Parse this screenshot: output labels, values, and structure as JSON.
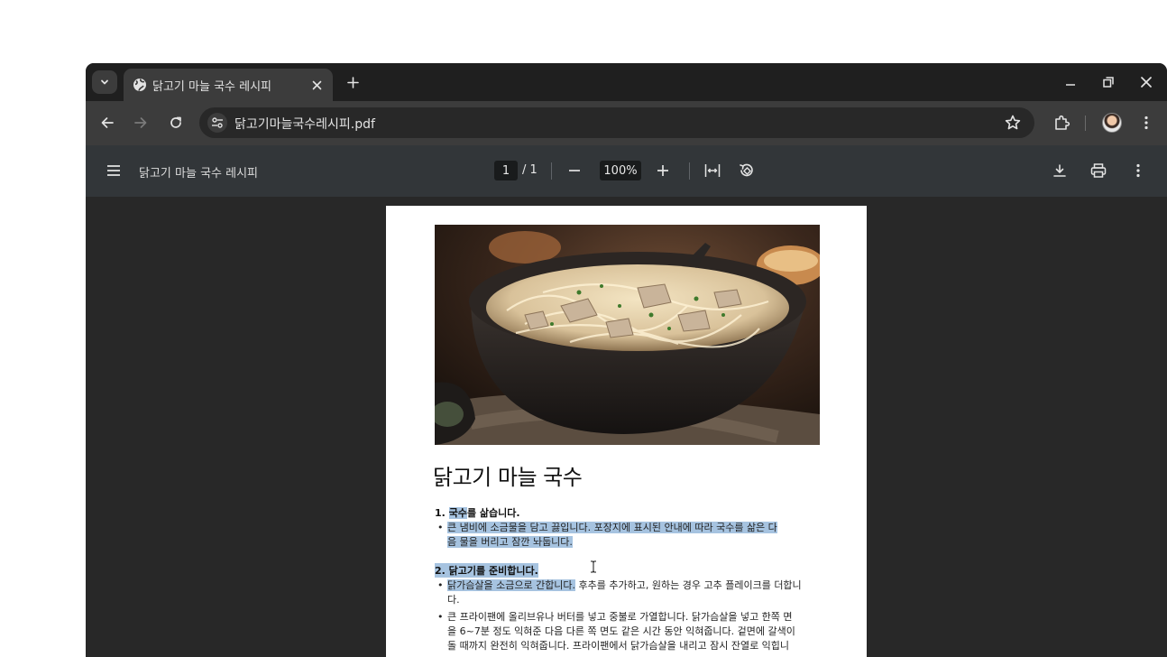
{
  "browser": {
    "tab_title": "닭고기 마늘 국수 레시피",
    "url": "닭고기마늘국수레시피.pdf"
  },
  "pdf_toolbar": {
    "title": "닭고기 마늘 국수 레시피",
    "page_current": "1",
    "page_total": "/ 1",
    "zoom": "100%"
  },
  "document": {
    "title": "닭고기 마늘 국수",
    "step1_heading_hl": "국수",
    "step1_heading_rest": "를 삶습니다.",
    "step1_number": "1.",
    "step1_bullet_line1": "큰 냄비에 소금물을 담고 끓입니다. 포장지에 표시된 안내에 따라 국수를 삶은 다",
    "step1_bullet_line2": "음 물을 버리고 잠깐 놔둡니다.",
    "step2_heading": "2. 닭고기를 준비합니다.",
    "step2_bullet1_hl": "닭가슴살을 소금으로 간합니다.",
    "step2_bullet1_rest": " 후추를 추가하고, 원하는 경우 고추 플레이크를 더합니",
    "step2_bullet1_line2": "다.",
    "step2_bullet2_line1": "큰 프라이팬에 올리브유나 버터를 넣고 중불로 가열합니다. 닭가슴살을 넣고 한쪽 면",
    "step2_bullet2_line2": "을 6~7분 정도 익혀준 다음 다른 쪽 면도 같은 시간 동안 익혀줍니다. 겉면에 갈색이",
    "step2_bullet2_line3": "돌 때까지 완전히 익혀줍니다. 프라이팬에서 닭가슴살을 내리고 잠시 잔열로 익힙니",
    "bullet_char": "•"
  },
  "colors": {
    "highlight": "#a6c3e0",
    "tab_active": "#3c3c3c",
    "pdf_bar": "#323639",
    "viewer_bg": "#282828"
  }
}
